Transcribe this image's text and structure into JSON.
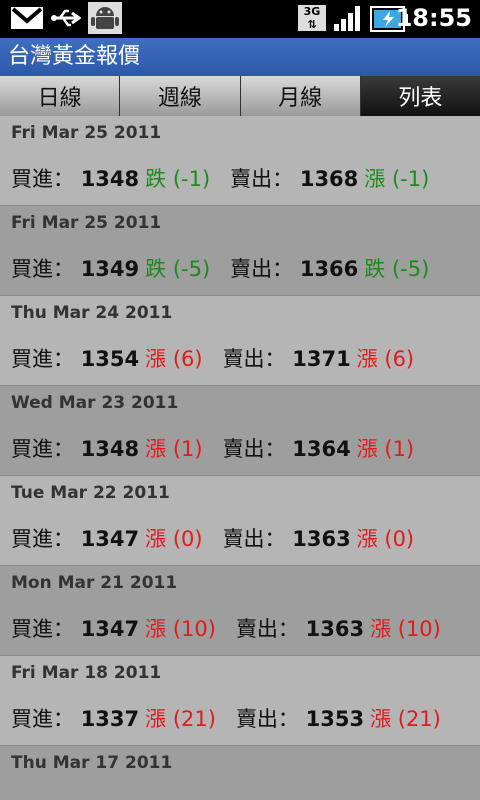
{
  "status": {
    "time": "18:55",
    "network": "3G"
  },
  "app": {
    "title": "台灣黃金報價"
  },
  "tabs": [
    {
      "label": "日線",
      "active": false
    },
    {
      "label": "週線",
      "active": false
    },
    {
      "label": "月線",
      "active": false
    },
    {
      "label": "列表",
      "active": true
    }
  ],
  "labels": {
    "buy": "買進：",
    "sell": "賣出："
  },
  "colors": {
    "up": "#e11b1b",
    "down": "#1b8c1b"
  },
  "rows": [
    {
      "date": "Fri Mar 25 2011",
      "buy": "1348",
      "buy_change": "跌 (-1)",
      "buy_dir": "down",
      "sell": "1368",
      "sell_change": "漲 (-1)",
      "sell_dir": "down"
    },
    {
      "date": "Fri Mar 25 2011",
      "buy": "1349",
      "buy_change": "跌 (-5)",
      "buy_dir": "down",
      "sell": "1366",
      "sell_change": "跌 (-5)",
      "sell_dir": "down"
    },
    {
      "date": "Thu Mar 24 2011",
      "buy": "1354",
      "buy_change": "漲 (6)",
      "buy_dir": "up",
      "sell": "1371",
      "sell_change": "漲 (6)",
      "sell_dir": "up"
    },
    {
      "date": "Wed Mar 23 2011",
      "buy": "1348",
      "buy_change": "漲 (1)",
      "buy_dir": "up",
      "sell": "1364",
      "sell_change": "漲 (1)",
      "sell_dir": "up"
    },
    {
      "date": "Tue Mar 22 2011",
      "buy": "1347",
      "buy_change": "漲 (0)",
      "buy_dir": "up",
      "sell": "1363",
      "sell_change": "漲 (0)",
      "sell_dir": "up"
    },
    {
      "date": "Mon Mar 21 2011",
      "buy": "1347",
      "buy_change": "漲 (10)",
      "buy_dir": "up",
      "sell": "1363",
      "sell_change": "漲 (10)",
      "sell_dir": "up"
    },
    {
      "date": "Fri Mar 18 2011",
      "buy": "1337",
      "buy_change": "漲 (21)",
      "buy_dir": "up",
      "sell": "1353",
      "sell_change": "漲 (21)",
      "sell_dir": "up"
    },
    {
      "date": "Thu Mar 17 2011",
      "buy": "",
      "buy_change": "",
      "buy_dir": "up",
      "sell": "",
      "sell_change": "",
      "sell_dir": "up"
    }
  ]
}
